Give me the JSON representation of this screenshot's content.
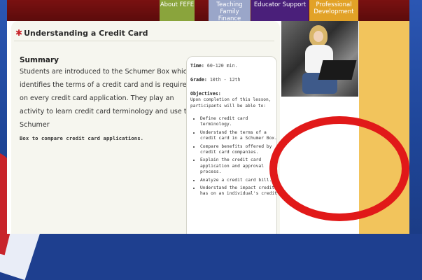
{
  "nav": {
    "about": "About FEFE",
    "teaching": "Teaching Family Finance",
    "educator": "Educator Support",
    "professional": "Professional Development"
  },
  "lesson": {
    "title": "Understanding a Credit Card",
    "summary_heading": "Summary",
    "summary_text": "Students are introduced to the Schumer Box which identifies the terms of a credit card and is required on every credit card application. They play an activity to learn credit card terminology and use the Schumer",
    "summary_text_tail": "Box to compare credit card applications."
  },
  "sidebar": {
    "time_label": "Time:",
    "time_value": "60-120 min.",
    "grade_label": "Grade:",
    "grade_value": "10th - 12th",
    "objectives_label": "Objectives:",
    "objectives_intro": "Upon completion of this lesson, participants will be able to:",
    "objectives": [
      "Define credit card terminology.",
      "Understand the terms of a credit card in a Schumer Box.",
      "Compare benefits offered by credit card companies.",
      "Explain the credit card application and approval process.",
      "Analyze a credit card bill.",
      "Understand the impact credit has on an individual's credit"
    ]
  },
  "colors": {
    "annotation_circle": "#e11919",
    "header": "#6b0f0f",
    "accent_strip": "#f2c45c"
  }
}
